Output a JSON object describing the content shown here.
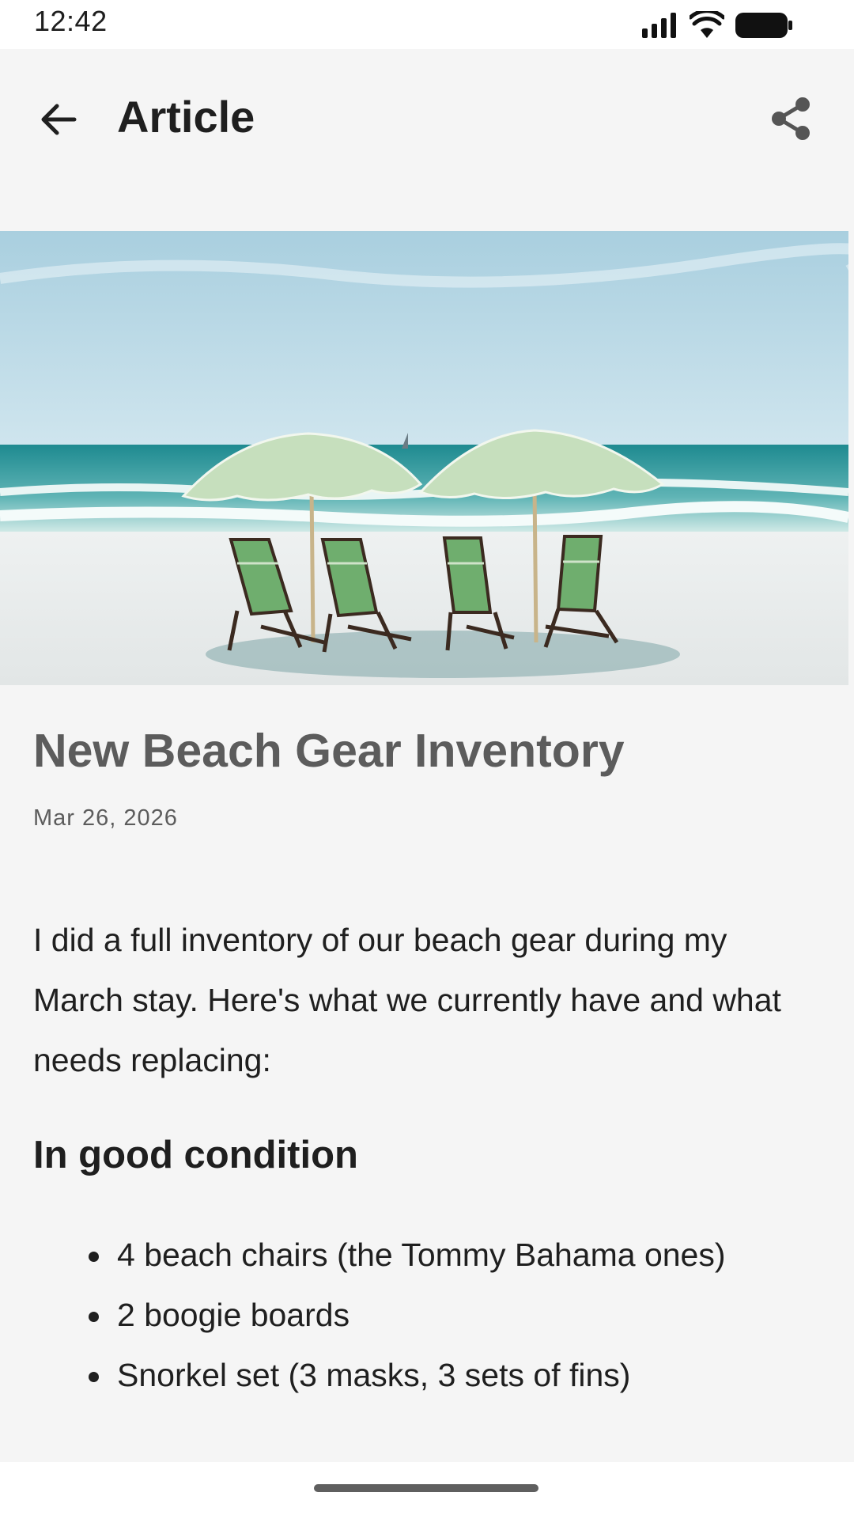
{
  "status_bar": {
    "time": "12:42",
    "icons": [
      "signal-icon",
      "wifi-icon",
      "battery-icon"
    ]
  },
  "app_bar": {
    "title": "Article",
    "back_icon": "arrow-left-icon",
    "share_icon": "share-icon"
  },
  "article": {
    "hero_image": "beach-umbrellas-chairs-image",
    "title": "New Beach Gear Inventory",
    "date": "Mar 26, 2026",
    "intro": "I did a full inventory of our beach gear during my March stay. Here's what we currently have and what needs replacing:",
    "section_heading": "In good condition",
    "items": [
      "4 beach chairs (the Tommy Bahama ones)",
      "2 boogie boards",
      "Snorkel set (3 masks, 3 sets of fins)"
    ]
  },
  "colors": {
    "background": "#f5f5f5",
    "text_primary": "#1f1f1f",
    "text_secondary": "#5c5c5c"
  }
}
